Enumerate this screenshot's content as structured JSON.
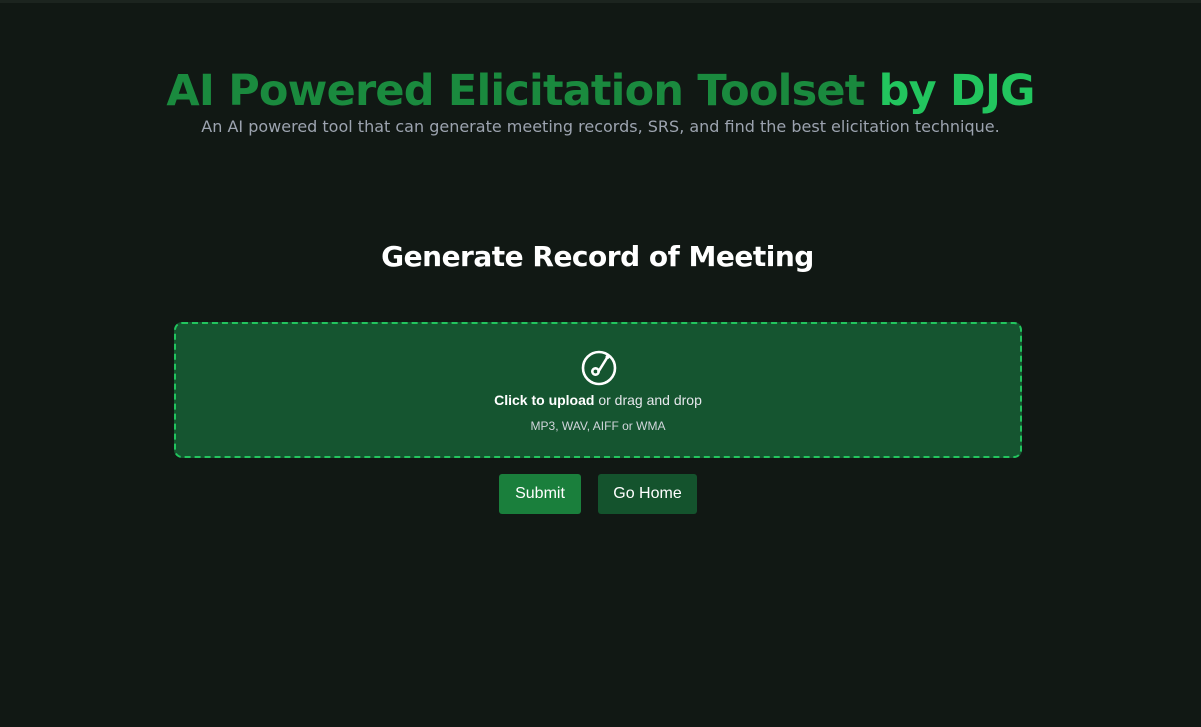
{
  "header": {
    "title_main": "AI Powered Elicitation Toolset",
    "title_accent": "by DJG",
    "subtitle": "An AI powered tool that can generate meeting records, SRS, and find the best elicitation technique."
  },
  "section": {
    "title": "Generate Record of Meeting"
  },
  "upload": {
    "icon": "audio-disc-icon",
    "cta_bold": "Click to upload",
    "cta_rest": "or drag and drop",
    "formats": "MP3, WAV, AIFF or WMA"
  },
  "actions": {
    "submit_label": "Submit",
    "home_label": "Go Home"
  },
  "colors": {
    "background": "#111814",
    "title_green": "#1a8a3e",
    "accent_green": "#22c55e",
    "dropzone_bg": "#155530",
    "submit_bg": "#1a7f3c",
    "home_bg": "#14532d"
  }
}
